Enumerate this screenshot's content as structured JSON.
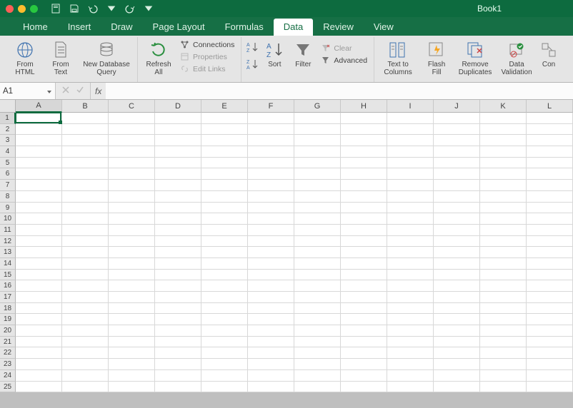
{
  "title": "Book1",
  "quick_access": [
    "save-file",
    "save",
    "undo",
    "redo"
  ],
  "tabs": [
    {
      "label": "Home",
      "active": false
    },
    {
      "label": "Insert",
      "active": false
    },
    {
      "label": "Draw",
      "active": false
    },
    {
      "label": "Page Layout",
      "active": false
    },
    {
      "label": "Formulas",
      "active": false
    },
    {
      "label": "Data",
      "active": true
    },
    {
      "label": "Review",
      "active": false
    },
    {
      "label": "View",
      "active": false
    }
  ],
  "ribbon": {
    "from_html": "From\nHTML",
    "from_text": "From\nText",
    "new_db_query": "New Database\nQuery",
    "refresh_all": "Refresh\nAll",
    "connections": "Connections",
    "properties": "Properties",
    "edit_links": "Edit Links",
    "sort": "Sort",
    "filter": "Filter",
    "clear": "Clear",
    "advanced": "Advanced",
    "text_to_columns": "Text to\nColumns",
    "flash_fill": "Flash\nFill",
    "remove_duplicates": "Remove\nDuplicates",
    "data_validation": "Data\nValidation",
    "consolidate": "Con"
  },
  "namebox": "A1",
  "fx_label": "fx",
  "formula_value": "",
  "columns": [
    "A",
    "B",
    "C",
    "D",
    "E",
    "F",
    "G",
    "H",
    "I",
    "J",
    "K",
    "L"
  ],
  "rows": [
    1,
    2,
    3,
    4,
    5,
    6,
    7,
    8,
    9,
    10,
    11,
    12,
    13,
    14,
    15,
    16,
    17,
    18,
    19,
    20,
    21,
    22,
    23,
    24,
    25
  ],
  "selected": {
    "col": 0,
    "row": 0
  }
}
